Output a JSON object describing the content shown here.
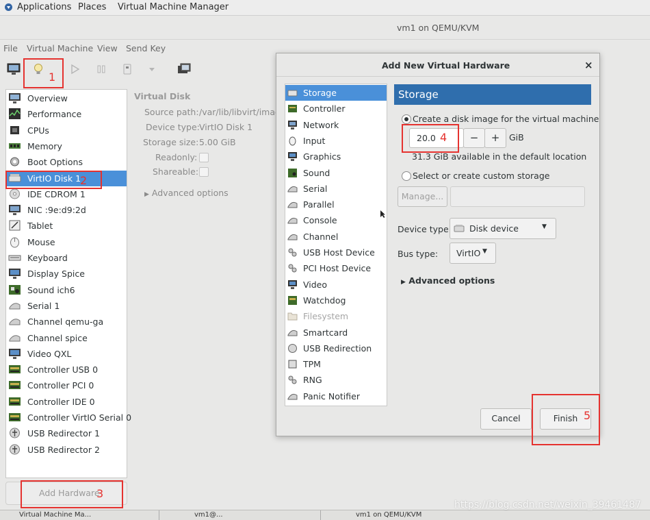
{
  "topbar": {
    "applications": "Applications",
    "places": "Places",
    "vmm": "Virtual Machine Manager"
  },
  "window": {
    "title": "vm1 on QEMU/KVM"
  },
  "menu": [
    "File",
    "Virtual Machine",
    "View",
    "Send Key"
  ],
  "sidebar": {
    "items": [
      {
        "label": "Overview"
      },
      {
        "label": "Performance"
      },
      {
        "label": "CPUs"
      },
      {
        "label": "Memory"
      },
      {
        "label": "Boot Options"
      },
      {
        "label": "VirtIO Disk 1"
      },
      {
        "label": "IDE CDROM 1"
      },
      {
        "label": "NIC :9e:d9:2d"
      },
      {
        "label": "Tablet"
      },
      {
        "label": "Mouse"
      },
      {
        "label": "Keyboard"
      },
      {
        "label": "Display Spice"
      },
      {
        "label": "Sound ich6"
      },
      {
        "label": "Serial 1"
      },
      {
        "label": "Channel qemu-ga"
      },
      {
        "label": "Channel spice"
      },
      {
        "label": "Video QXL"
      },
      {
        "label": "Controller USB 0"
      },
      {
        "label": "Controller PCI 0"
      },
      {
        "label": "Controller IDE 0"
      },
      {
        "label": "Controller VirtIO Serial 0"
      },
      {
        "label": "USB Redirector 1"
      },
      {
        "label": "USB Redirector 2"
      }
    ],
    "selected_label": "VirtIO Disk 1",
    "add_hardware": "Add Hardware"
  },
  "detail": {
    "heading": "Virtual Disk",
    "source_path_label": "Source path:",
    "source_path_value": "/var/lib/libvirt/image",
    "device_type_label": "Device type:",
    "device_type_value": "VirtIO Disk 1",
    "storage_size_label": "Storage size:",
    "storage_size_value": "5.00 GiB",
    "readonly_label": "Readonly:",
    "shareable_label": "Shareable:",
    "advanced": "Advanced options"
  },
  "dialog": {
    "title": "Add New Virtual Hardware",
    "close": "×",
    "hardware": [
      {
        "label": "Storage"
      },
      {
        "label": "Controller"
      },
      {
        "label": "Network"
      },
      {
        "label": "Input"
      },
      {
        "label": "Graphics"
      },
      {
        "label": "Sound"
      },
      {
        "label": "Serial"
      },
      {
        "label": "Parallel"
      },
      {
        "label": "Console"
      },
      {
        "label": "Channel"
      },
      {
        "label": "USB Host Device"
      },
      {
        "label": "PCI Host Device"
      },
      {
        "label": "Video"
      },
      {
        "label": "Watchdog"
      },
      {
        "label": "Filesystem"
      },
      {
        "label": "Smartcard"
      },
      {
        "label": "USB Redirection"
      },
      {
        "label": "TPM"
      },
      {
        "label": "RNG"
      },
      {
        "label": "Panic Notifier"
      }
    ],
    "selected": "Storage",
    "section_title": "Storage",
    "create_radio": "Create a disk image for the virtual machine",
    "size_value": "20.0",
    "minus": "−",
    "plus": "+",
    "unit": "GiB",
    "available": "31.3 GiB available in the default location",
    "custom_radio": "Select or create custom storage",
    "manage": "Manage...",
    "device_type_label": "Device type:",
    "device_type_value": "Disk device",
    "bus_type_label": "Bus type:",
    "bus_type_value": "VirtIO",
    "advanced": "Advanced options",
    "cancel": "Cancel",
    "finish": "Finish"
  },
  "annotations": [
    "1",
    "2",
    "3",
    "4",
    "5"
  ],
  "watermark": "https://blog.csdn.net/weixin_39461487",
  "status_items": [
    "Virtual Machine Ma...",
    "vm1@...",
    "vm1 on QEMU/KVM"
  ],
  "colors": {
    "selection": "#4a90d9",
    "header": "#2f6ead",
    "annotation": "#e5322f"
  }
}
